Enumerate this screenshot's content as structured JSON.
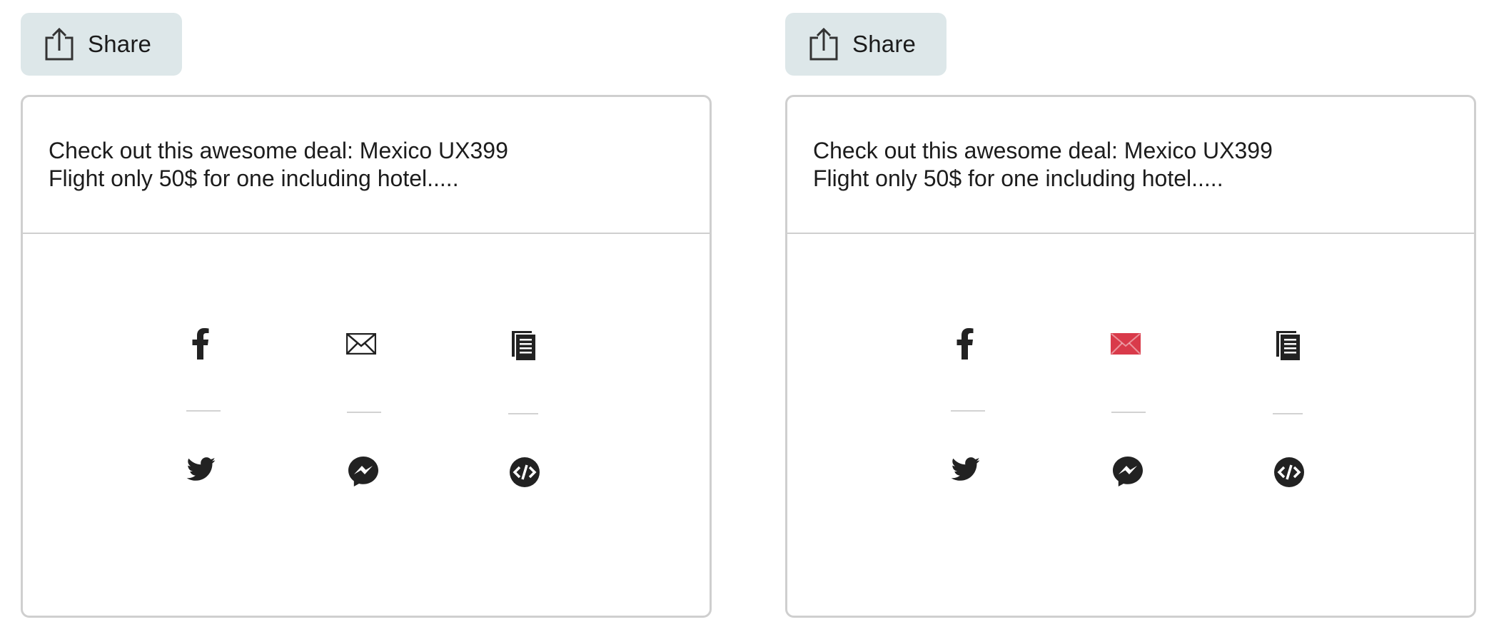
{
  "panels": [
    {
      "id": "default",
      "share_button": {
        "label": "Share"
      },
      "message": {
        "line1": "Check out this awesome deal: Mexico UX399",
        "line2": "Flight only 50$ for one including hotel....."
      },
      "icons": {
        "facebook": "facebook-icon",
        "email": "email-icon",
        "copy": "copy-icon",
        "twitter": "twitter-icon",
        "messenger": "messenger-icon",
        "embed": "embed-icon"
      },
      "email_color": "#222222"
    },
    {
      "id": "email-hover",
      "share_button": {
        "label": "Share"
      },
      "message": {
        "line1": "Check out this awesome deal: Mexico UX399",
        "line2": "Flight only 50$ for one including hotel....."
      },
      "icons": {
        "facebook": "facebook-icon",
        "email": "email-icon",
        "copy": "copy-icon",
        "twitter": "twitter-icon",
        "messenger": "messenger-icon",
        "embed": "embed-icon"
      },
      "email_color": "#d93a4a"
    }
  ],
  "colors": {
    "button_bg": "#dde7e9",
    "icon_dark": "#222222",
    "email_active": "#d93a4a",
    "border": "#cfcfcf"
  }
}
